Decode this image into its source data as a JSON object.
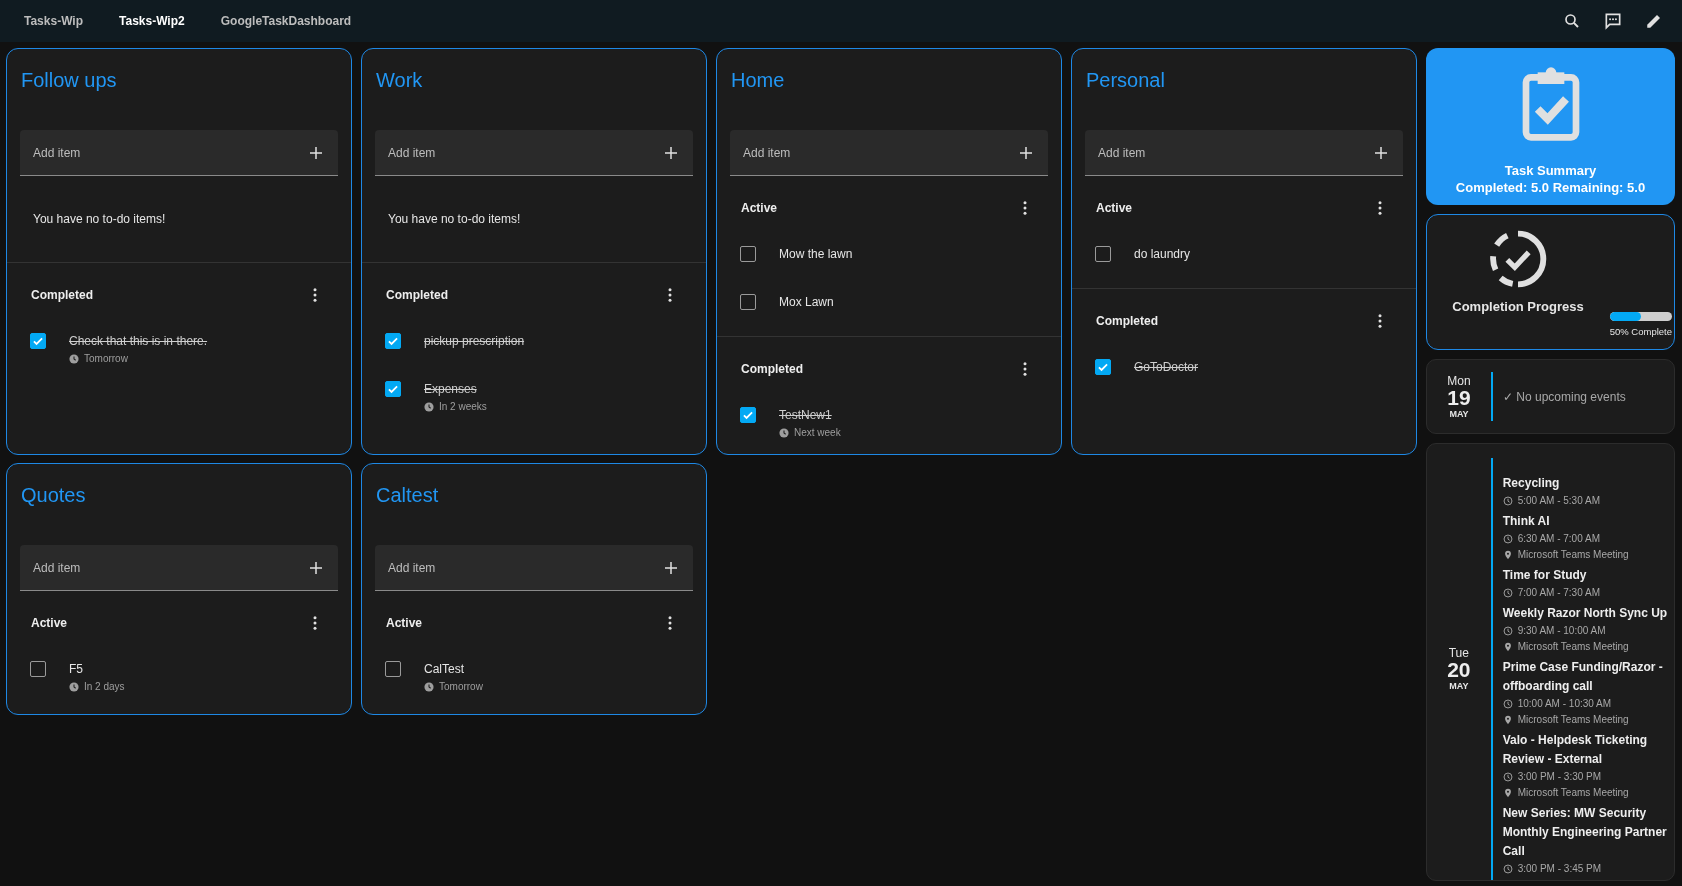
{
  "nav": {
    "tabs": [
      {
        "label": "Tasks-Wip",
        "selected": false
      },
      {
        "label": "Tasks-Wip2",
        "selected": true
      },
      {
        "label": "GoogleTaskDashboard",
        "selected": false
      }
    ]
  },
  "lists": [
    {
      "title": "Follow ups",
      "add_placeholder": "Add item",
      "empty_text": "You have no to-do items!",
      "sections": [
        {
          "heading": "Completed",
          "items": [
            {
              "text": "Check that this is in there.",
              "checked": true,
              "due": "Tomorrow"
            }
          ]
        }
      ]
    },
    {
      "title": "Work",
      "add_placeholder": "Add item",
      "empty_text": "You have no to-do items!",
      "sections": [
        {
          "heading": "Completed",
          "items": [
            {
              "text": "pickup prescription",
              "checked": true
            },
            {
              "text": "Expenses",
              "checked": true,
              "due": "In 2 weeks"
            }
          ]
        }
      ]
    },
    {
      "title": "Home",
      "add_placeholder": "Add item",
      "sections": [
        {
          "heading": "Active",
          "items": [
            {
              "text": "Mow the lawn",
              "checked": false
            },
            {
              "text": "Mox Lawn",
              "checked": false
            }
          ]
        },
        {
          "heading": "Completed",
          "items": [
            {
              "text": "TestNew1",
              "checked": true,
              "due": "Next week"
            }
          ]
        }
      ]
    },
    {
      "title": "Personal",
      "add_placeholder": "Add item",
      "sections": [
        {
          "heading": "Active",
          "items": [
            {
              "text": "do laundry",
              "checked": false
            }
          ]
        },
        {
          "heading": "Completed",
          "items": [
            {
              "text": "GoToDoctor",
              "checked": true
            }
          ]
        }
      ]
    },
    {
      "title": "Quotes",
      "add_placeholder": "Add item",
      "sections": [
        {
          "heading": "Active",
          "items": [
            {
              "text": "F5",
              "checked": false,
              "due": "In 2 days"
            }
          ]
        }
      ]
    },
    {
      "title": "Caltest",
      "add_placeholder": "Add item",
      "sections": [
        {
          "heading": "Active",
          "items": [
            {
              "text": "CalTest",
              "checked": false,
              "due": "Tomorrow"
            }
          ]
        }
      ]
    }
  ],
  "summary": {
    "title": "Task Summary",
    "text": "Completed: 5.0 Remaining: 5.0"
  },
  "progress": {
    "title": "Completion Progress",
    "level": 0.5,
    "label": "50% Complete"
  },
  "agenda": [
    {
      "weekday": "Mon",
      "day": "19",
      "month": "MAY",
      "empty_text": "✓ No upcoming events"
    },
    {
      "weekday": "Tue",
      "day": "20",
      "month": "MAY",
      "events": [
        {
          "title": "Recycling",
          "time": "5:00 AM - 5:30 AM"
        },
        {
          "title": "Think AI",
          "time": "6:30 AM - 7:00 AM",
          "location": "Microsoft Teams Meeting"
        },
        {
          "title": "Time for Study",
          "time": "7:00 AM - 7:30 AM"
        },
        {
          "title": "Weekly Razor North Sync Up",
          "time": "9:30 AM - 10:00 AM",
          "location": "Microsoft Teams Meeting"
        },
        {
          "title": "Prime Case Funding/Razor - offboarding call",
          "time": "10:00 AM - 10:30 AM",
          "location": "Microsoft Teams Meeting"
        },
        {
          "title": "Valo - Helpdesk Ticketing Review - External",
          "time": "3:00 PM - 3:30 PM",
          "location": "Microsoft Teams Meeting"
        },
        {
          "title": "New Series: MW Security Monthly Engineering Partner Call",
          "time": "3:00 PM - 3:45 PM"
        }
      ]
    }
  ]
}
